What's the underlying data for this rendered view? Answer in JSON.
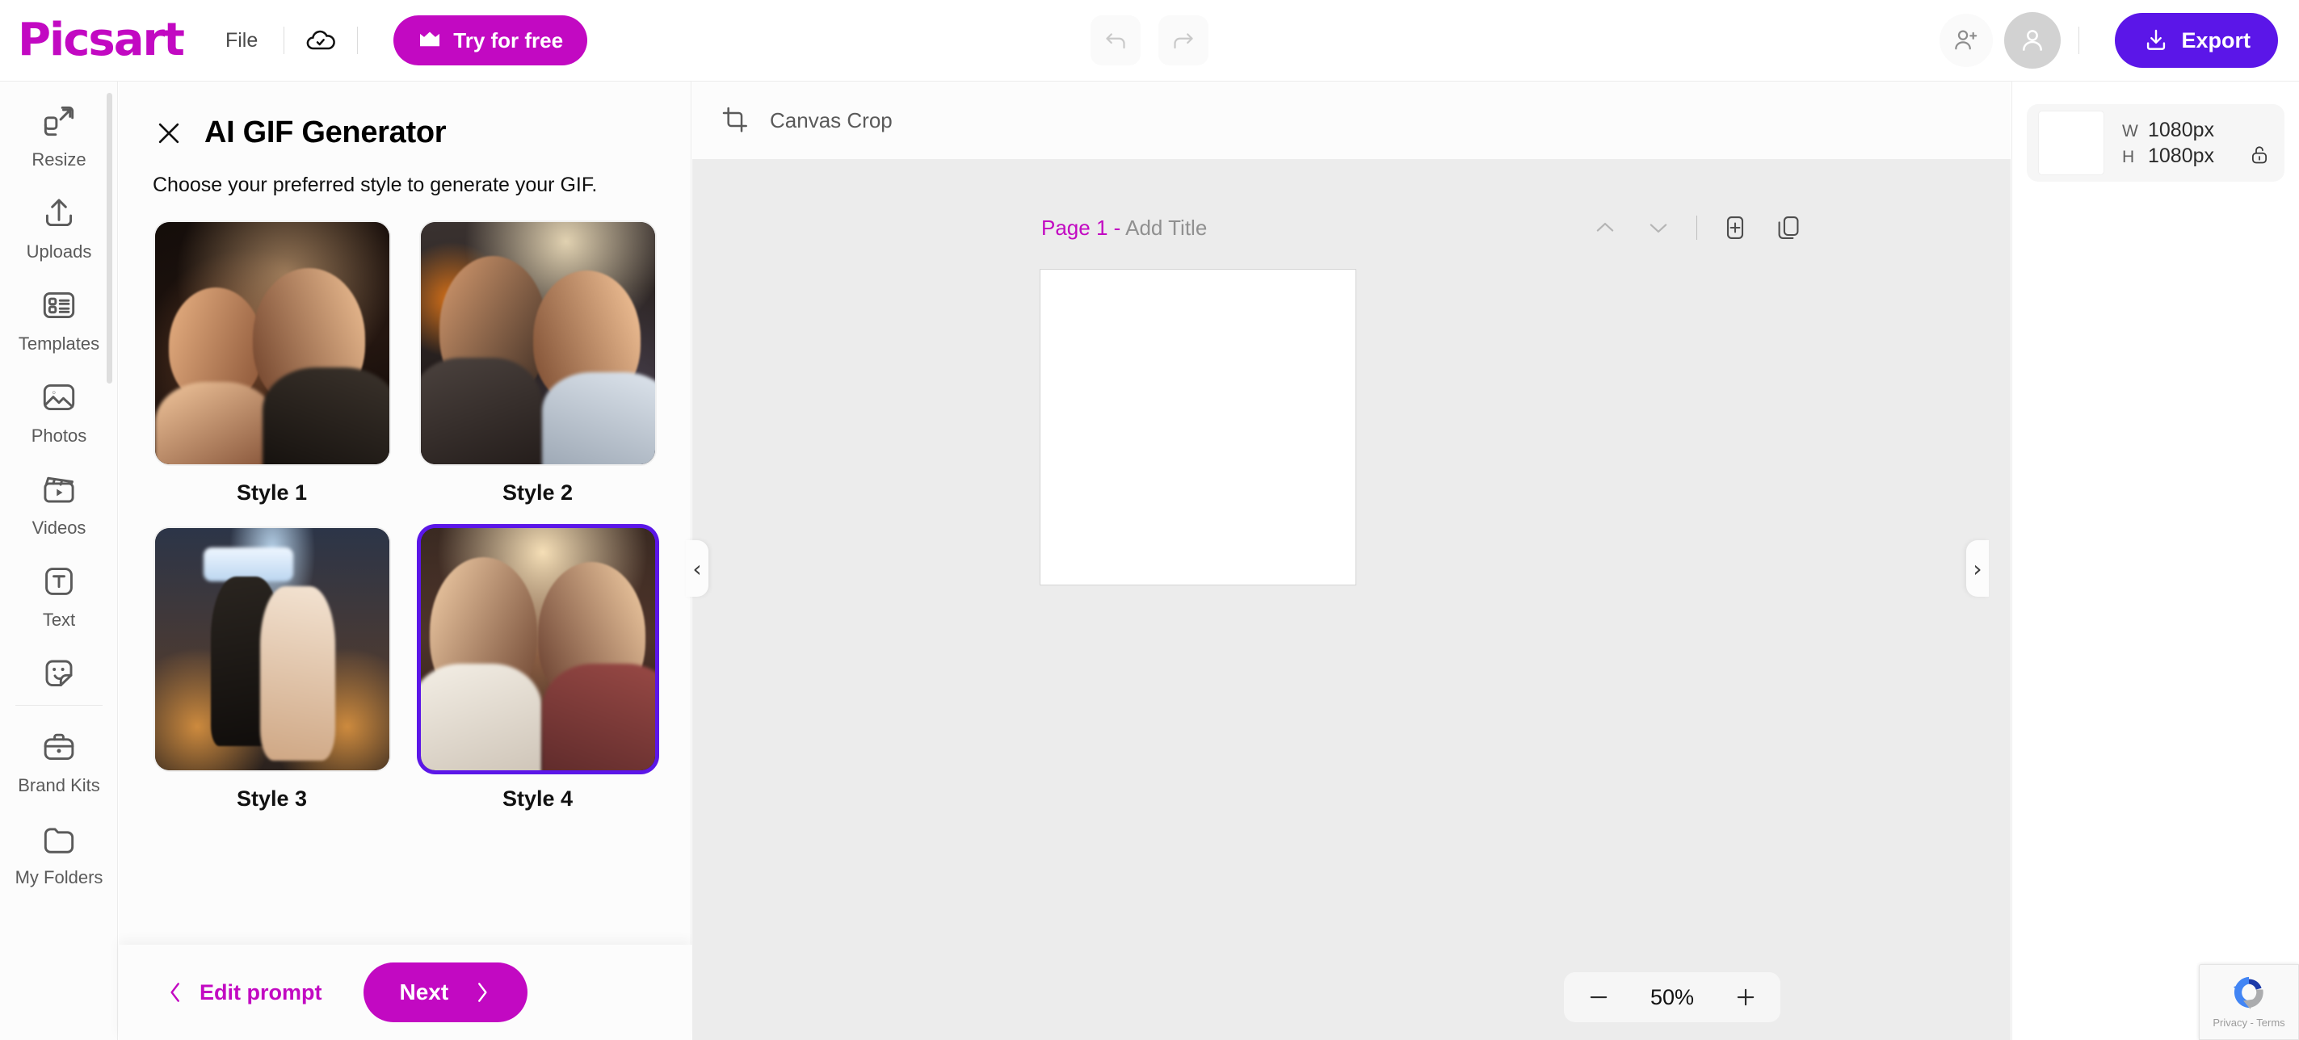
{
  "header": {
    "logo": "Picsart",
    "file_menu": "File",
    "cloud_icon": "cloud-check-icon",
    "try_label": "Try for free",
    "crown_icon": "crown-icon",
    "undo_icon": "undo-icon",
    "redo_icon": "redo-icon",
    "invite_icon": "add-person-icon",
    "avatar_icon": "user-avatar-icon",
    "export_label": "Export",
    "export_icon": "download-icon",
    "brand_color": "#C209C2",
    "export_color": "#5B16E8"
  },
  "sidebar": {
    "items": [
      {
        "label": "Resize",
        "icon": "resize-icon"
      },
      {
        "label": "Uploads",
        "icon": "upload-icon"
      },
      {
        "label": "Templates",
        "icon": "templates-icon"
      },
      {
        "label": "Photos",
        "icon": "photos-icon"
      },
      {
        "label": "Videos",
        "icon": "videos-icon"
      },
      {
        "label": "Text",
        "icon": "text-icon"
      },
      {
        "label": "",
        "icon": "stickers-icon"
      },
      {
        "label": "Brand Kits",
        "icon": "brand-kits-icon"
      },
      {
        "label": "My Folders",
        "icon": "my-folders-icon"
      }
    ]
  },
  "panel": {
    "close_icon": "close-icon",
    "title": "AI GIF Generator",
    "subtitle": "Choose your preferred style to generate your GIF.",
    "styles": [
      {
        "label": "Style 1",
        "selected": false
      },
      {
        "label": "Style 2",
        "selected": false
      },
      {
        "label": "Style 3",
        "selected": false
      },
      {
        "label": "Style 4",
        "selected": true
      }
    ],
    "selected_style": "Style 4",
    "selection_color": "#5B16E8",
    "back_label": "Edit prompt",
    "back_icon": "chevron-left-icon",
    "next_label": "Next",
    "next_icon": "chevron-right-icon"
  },
  "canvas": {
    "crop_tool_label": "Canvas Crop",
    "crop_tool_icon": "crop-icon",
    "page_number": "Page 1",
    "page_separator": "-",
    "page_title_placeholder": "Add Title",
    "move_up_icon": "chevron-up-icon",
    "move_down_icon": "chevron-down-icon",
    "add_page_icon": "add-page-icon",
    "duplicate_page_icon": "duplicate-page-icon",
    "collapse_left_icon": "chevron-left-icon",
    "collapse_right_icon": "chevron-right-icon",
    "zoom_out_icon": "minus-icon",
    "zoom_level": "50%",
    "zoom_in_icon": "plus-icon"
  },
  "right_panel": {
    "width_key": "W",
    "width_value": "1080px",
    "height_key": "H",
    "height_value": "1080px",
    "lock_icon": "unlocked-icon"
  },
  "recaptcha": {
    "icon": "recaptcha-logo-icon",
    "text": "Privacy - Terms"
  }
}
